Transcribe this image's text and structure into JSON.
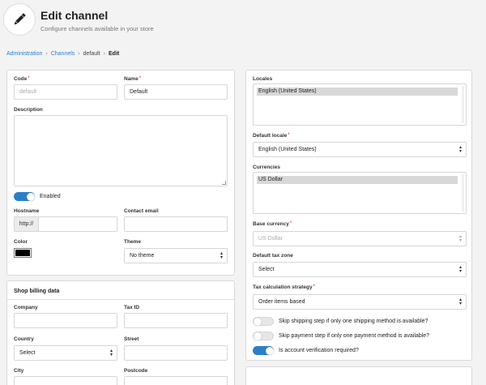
{
  "header": {
    "title": "Edit channel",
    "subtitle": "Configure channels available in your store",
    "icon": "pencil-icon"
  },
  "breadcrumb": {
    "items": [
      "Administration",
      "Channels",
      "default",
      "Edit"
    ]
  },
  "general": {
    "code": {
      "label": "Code",
      "placeholder": "default",
      "value": ""
    },
    "name": {
      "label": "Name",
      "value": "Default"
    },
    "description": {
      "label": "Description",
      "value": ""
    },
    "enabled": {
      "label": "Enabled",
      "on": true
    },
    "hostname": {
      "label": "Hostname",
      "prefix": "http://",
      "value": ""
    },
    "contact_email": {
      "label": "Contact email",
      "value": ""
    },
    "color": {
      "label": "Color",
      "value": "#000000"
    },
    "theme": {
      "label": "Theme",
      "value": "No theme"
    }
  },
  "billing": {
    "title": "Shop billing data",
    "company": {
      "label": "Company",
      "value": ""
    },
    "tax_id": {
      "label": "Tax ID",
      "value": ""
    },
    "country": {
      "label": "Country",
      "value": "Select"
    },
    "street": {
      "label": "Street",
      "value": ""
    },
    "city": {
      "label": "City"
    },
    "postcode": {
      "label": "Postcode"
    }
  },
  "settings": {
    "locales": {
      "label": "Locales",
      "selected": "English (United States)"
    },
    "default_locale": {
      "label": "Default locale",
      "value": "English (United States)"
    },
    "currencies": {
      "label": "Currencies",
      "selected": "US Dollar"
    },
    "base_currency": {
      "label": "Base currency",
      "value": "US Dollar"
    },
    "default_tax_zone": {
      "label": "Default tax zone",
      "value": "Select"
    },
    "tax_strategy": {
      "label": "Tax calculation strategy",
      "value": "Order items based"
    },
    "skip_shipping": {
      "label": "Skip shipping step if only one shipping method is available?",
      "on": false
    },
    "skip_payment": {
      "label": "Skip payment step if only one payment method is available?",
      "on": false
    },
    "account_verification": {
      "label": "Is account verification required?",
      "on": true
    }
  },
  "colors": {
    "accent": "#2b7fc9",
    "required": "#d0021b",
    "background": "#f3f3f4"
  }
}
